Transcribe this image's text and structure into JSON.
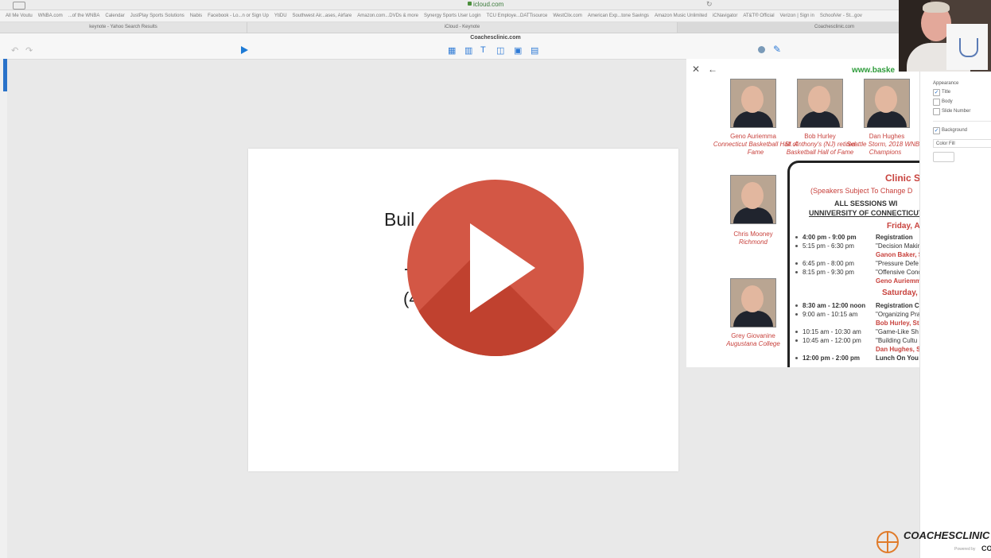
{
  "browser": {
    "url": "icloud.com",
    "bookmarks": [
      "All Me Voutu",
      "WNBA.com",
      "...of the WNBA",
      "Calendar",
      "JustPlay Sports Solutions",
      "Nabis",
      "Facebook - Lo...n or Sign Up",
      "YtiDU",
      "Southwest Air...ases, Airfare",
      "Amazon.com...DVDs & more",
      "Synergy Sports User Login",
      "TCU Employe...DATTisource",
      "WestClix.com",
      "American Exp...tone Savings",
      "Amazon Music Unlimited",
      "iCNavigator",
      "AT&T® Official",
      "Verizon | Sign in",
      "SchoolVer - St...gov"
    ],
    "tabs": [
      "keynote - Yahoo Search Results",
      "iCloud - Keynote",
      "Coachesclinic.com"
    ]
  },
  "toolbar": {
    "document_title": "Coachesclinic.com",
    "icons": [
      "undo-icon",
      "redo-icon",
      "play-icon",
      "table-icon",
      "chart-icon",
      "text-icon",
      "shape-icon",
      "media-icon",
      "comment-icon",
      "collaborate-icon",
      "format-icon"
    ]
  },
  "slide": {
    "title_fragment": "Buil",
    "line2_fragment": "-",
    "line3_fragment": "(4"
  },
  "popup": {
    "url": "www.baske",
    "coaches_row1": [
      {
        "name": "Geno Auriemma",
        "detail": "Connecticut Basketball Hall of Fame"
      },
      {
        "name": "Bob Hurley",
        "detail": "St. Anthony's (NJ) retired Basketball Hall of Fame"
      },
      {
        "name": "Dan Hughes",
        "detail": "Seattle Storm, 2018 WNBA Champions"
      }
    ],
    "coaches_col": [
      {
        "name": "Chris Mooney",
        "detail": "Richmond"
      },
      {
        "name": "Grey Giovanine",
        "detail": "Augustana College"
      }
    ],
    "schedule": {
      "title": "Clinic S",
      "subtitle": "(Speakers Subject To Change D",
      "venue_line1": "ALL SESSIONS WI",
      "venue_line2": "UNNIVERSITY OF CONNECTICUT",
      "day1": "Friday, Ap",
      "day1_items": [
        {
          "time": "4:00 pm - 9:00 pm",
          "event": "Registration",
          "bold": true
        },
        {
          "time": "5:15 pm - 6:30 pm",
          "event": "\"Decision Makin",
          "speaker": "Ganon Baker, S"
        },
        {
          "time": "6:45 pm - 8:00 pm",
          "event": "\"Pressure Defe"
        },
        {
          "time": "8:15 pm - 9:30 pm",
          "event": "\"Offensive Conc",
          "speaker": "Geno Auriemm"
        }
      ],
      "day2": "Saturday, A",
      "day2_items": [
        {
          "time": "8:30 am - 12:00 noon",
          "event": "Registration C",
          "bold": true
        },
        {
          "time": "9:00 am - 10:15 am",
          "event": "\"Organizing Pra",
          "speaker": "Bob Hurley, St"
        },
        {
          "time": "10:15 am - 10:30 am",
          "event": "\"Game-Like Sh"
        },
        {
          "time": "10:45 am - 12:00 pm",
          "event": "\"Building Cultu",
          "speaker": "Dan Hughes, S"
        },
        {
          "time": "12:00 pm - 2:00 pm",
          "event": "Lunch On You",
          "bold": true
        }
      ]
    }
  },
  "inspector": {
    "appearance_label": "Appearance",
    "title_label": "Title",
    "title_checked": true,
    "body_label": "Body",
    "body_checked": false,
    "slide_number_label": "Slide Number",
    "slide_number_checked": false,
    "background_label": "Background",
    "background_checked": true,
    "fill_option": "Color Fill"
  },
  "logo": {
    "text": "COACHESCLINIC",
    "powered": "Powered by",
    "powered_brand": "CO"
  }
}
